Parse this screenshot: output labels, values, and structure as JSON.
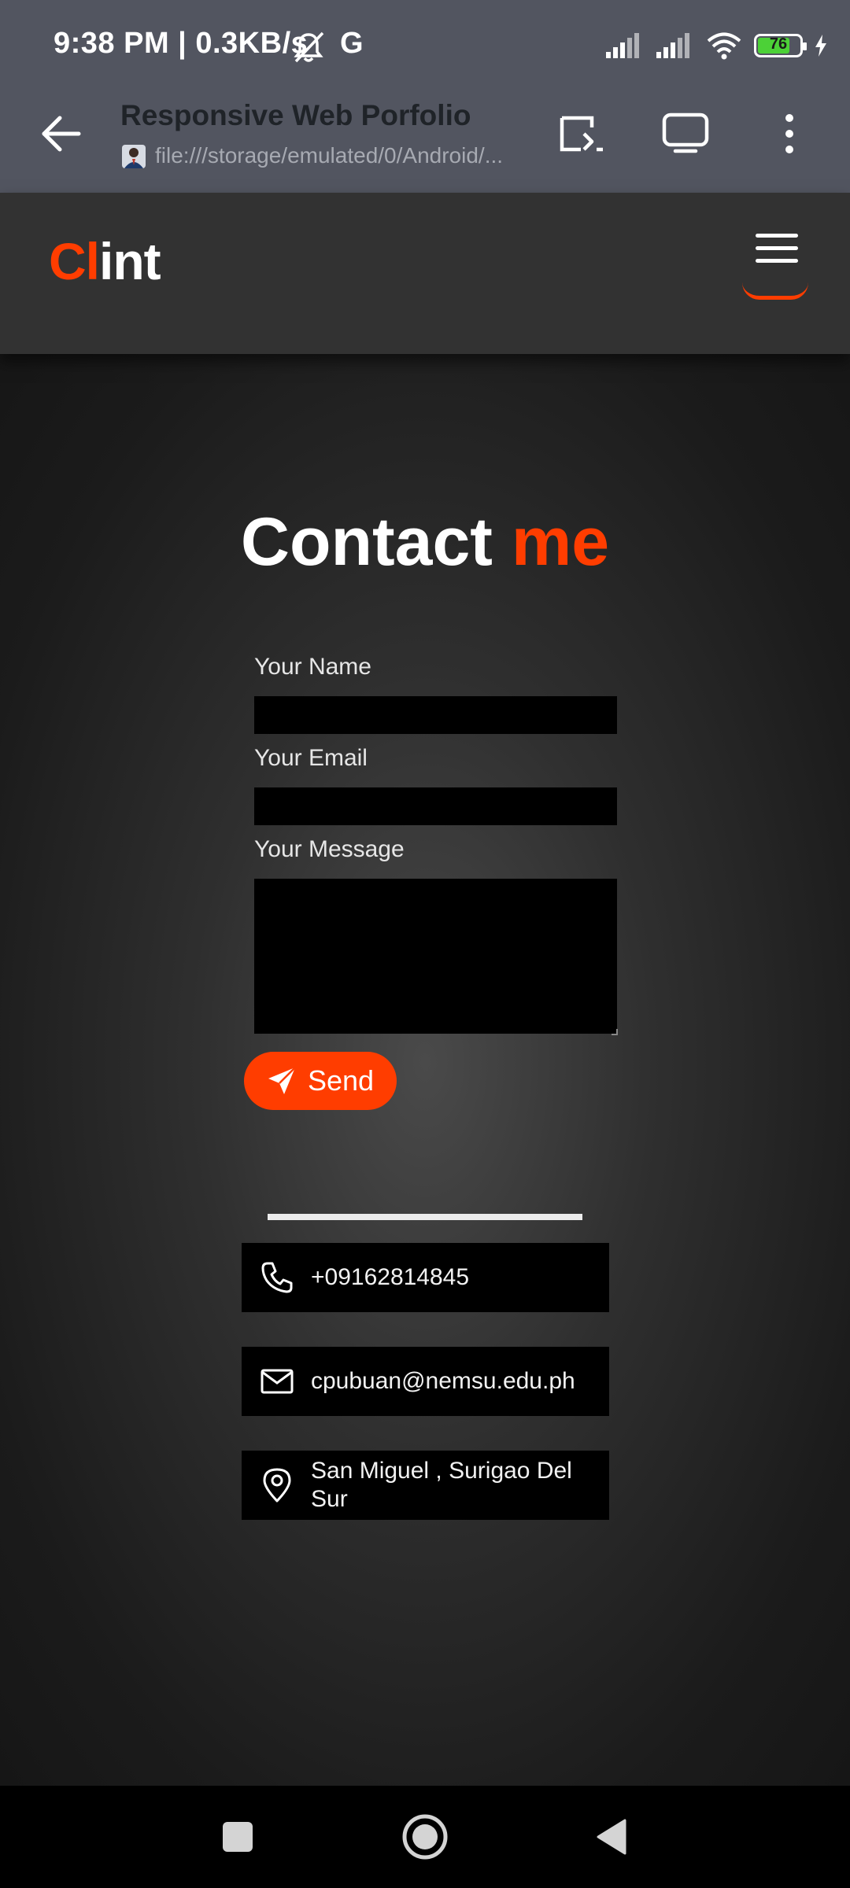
{
  "status_bar": {
    "time_speed": "9:38 PM | 0.3KB/s",
    "g_icon_label": "G",
    "battery_level": "76",
    "battery_fraction": 0.76
  },
  "browser": {
    "page_title": "Responsive Web Porfolio",
    "url": "file:///storage/emulated/0/Android/..."
  },
  "header": {
    "logo_accent": "Cl",
    "logo_rest": "int"
  },
  "contact": {
    "heading_main": "Contact ",
    "heading_accent": "me",
    "name_label": "Your Name",
    "email_label": "Your Email",
    "message_label": "Your Message",
    "send_label": "Send"
  },
  "info": {
    "phone": "+09162814845",
    "email": "cpubuan@nemsu.edu.ph",
    "address": "San Miguel , Surigao Del Sur"
  },
  "colors": {
    "accent": "#ff3d00",
    "chrome_bg": "#525560",
    "header_bg": "#323232"
  },
  "icons": [
    "mute-bell-icon",
    "signal-icon",
    "wifi-icon",
    "battery-icon",
    "charging-icon",
    "back-arrow-icon",
    "cast-icon",
    "tablet-icon",
    "more-vert-icon",
    "hamburger-icon",
    "send-plane-icon",
    "phone-icon",
    "mail-icon",
    "location-pin-icon",
    "recents-icon",
    "home-icon",
    "back-triangle-icon"
  ]
}
